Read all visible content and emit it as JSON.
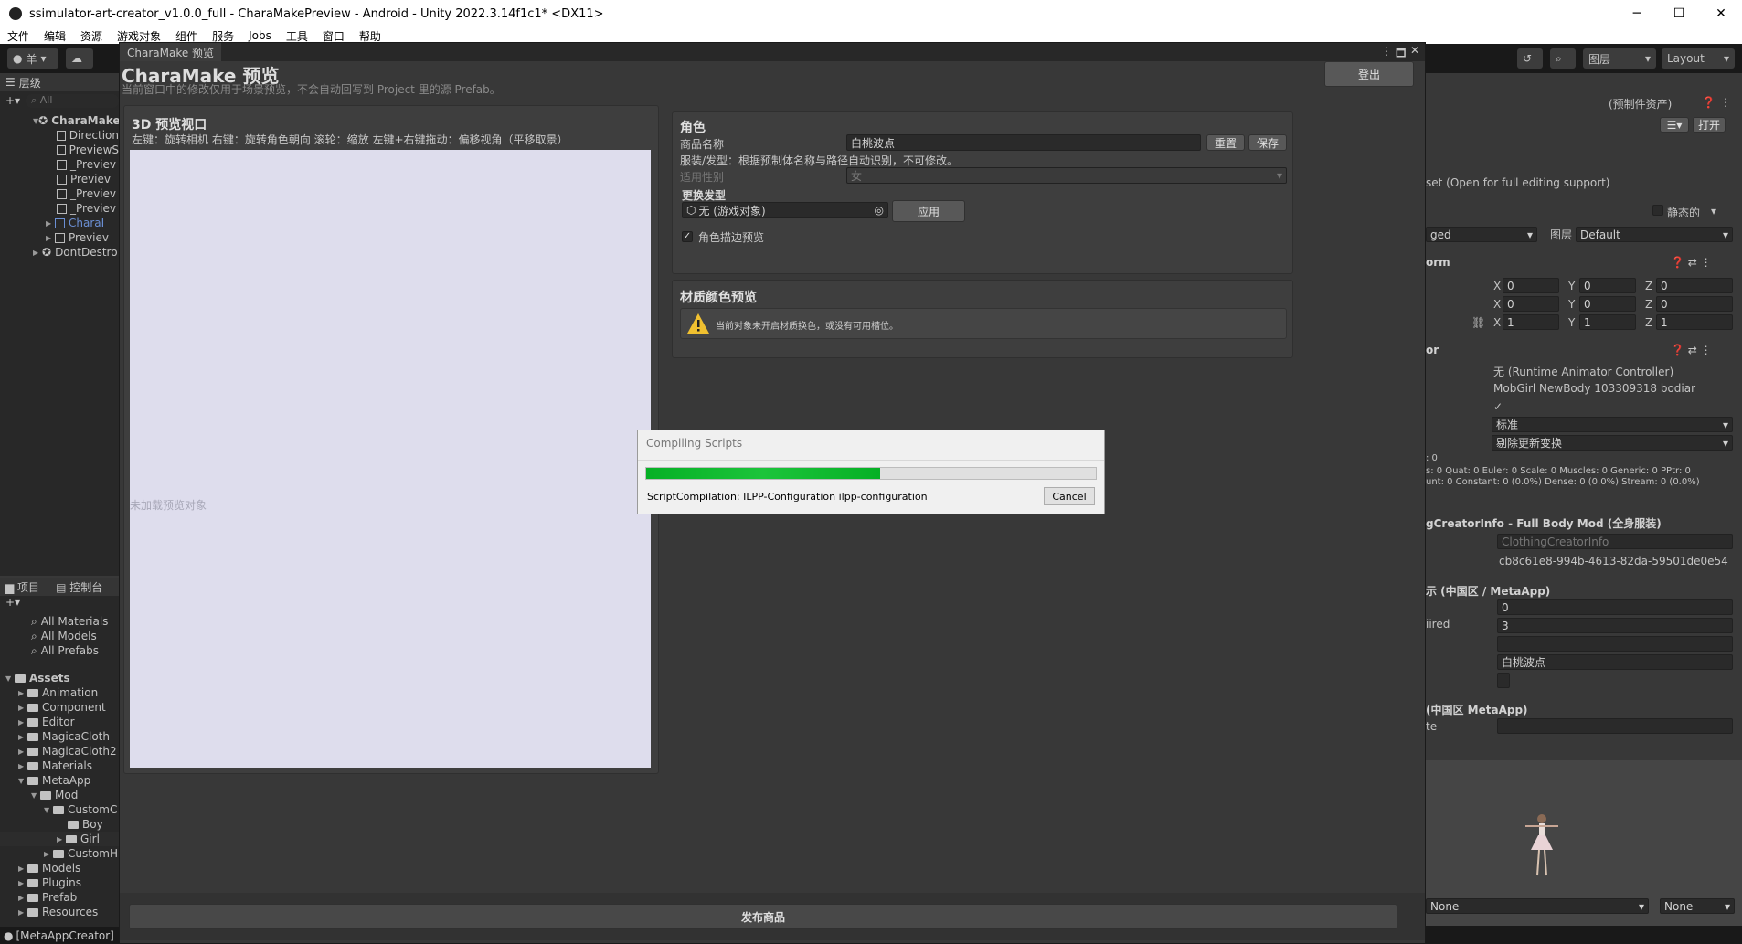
{
  "titlebar": {
    "title": "ssimulator-art-creator_v1.0.0_full - CharaMakePreview - Android - Unity 2022.3.14f1c1* <DX11>",
    "minimize": "─",
    "maximize": "☐",
    "close": "✕"
  },
  "menu": [
    "文件",
    "编辑",
    "资源",
    "游戏对象",
    "组件",
    "服务",
    "Jobs",
    "工具",
    "窗口",
    "帮助"
  ],
  "toolbar": {
    "account": "羊",
    "layers": "图层",
    "layout": "Layout"
  },
  "hierarchy": {
    "tab": "层级",
    "search": "All",
    "items": [
      "CharaMake",
      "Direction",
      "PreviewS",
      "_Previev",
      "Previev",
      "_Previev",
      "_Previev",
      "CharaI",
      "Previev",
      "DontDestro"
    ]
  },
  "project": {
    "tab_project": "项目",
    "tab_console": "控制台",
    "favorites": [
      "All Materials",
      "All Models",
      "All Prefabs"
    ],
    "assets_root": "Assets",
    "folders": [
      "Animation",
      "Component",
      "Editor",
      "MagicaCloth",
      "MagicaCloth2",
      "Materials",
      "MetaApp",
      "Mod",
      "CustomC",
      "Boy",
      "Girl",
      "CustomH",
      "Models",
      "Plugins",
      "Prefab",
      "Resources"
    ],
    "status": "[MetaAppCreator]"
  },
  "window": {
    "tab": "CharaMake 预览",
    "title": "CharaMake 预览",
    "subtitle": "当前窗口中的修改仅用于场景预览，不会自动回写到 Project 里的源 Prefab。",
    "logout": "登出"
  },
  "viewport": {
    "title": "3D 预览视口",
    "hint": "左键：旋转相机    右键：旋转角色朝向    滚轮：缩放    左键+右键拖动：偏移视角（平移取景）",
    "empty": "未加载预览对象"
  },
  "role": {
    "title": "角色",
    "name_label": "商品名称",
    "name_value": "白桃波点",
    "reset": "重置",
    "save": "保存",
    "info": "服装/发型：根据预制体名称与路径自动识别，不可修改。",
    "gender_label": "适用性别",
    "gender_value": "女",
    "hair_label": "更换发型",
    "hair_value": "无 (游戏对象)",
    "apply": "应用",
    "outline": "角色描边预览"
  },
  "material": {
    "title": "材质颜色预览",
    "warning": "当前对象未开启材质换色，或没有可用槽位。"
  },
  "publish": "发布商品",
  "dialog": {
    "title": "Compiling Scripts",
    "progress": 0.52,
    "status": "ScriptCompilation: ILPP-Configuration ilpp-configuration",
    "cancel": "Cancel"
  },
  "inspector": {
    "prefab_asset": "(预制件资产)",
    "open": "打开",
    "open_note": "set (Open for full editing support)",
    "static": "静态的",
    "tag": "ged",
    "layer_label": "图层",
    "layer": "Default",
    "transform": "orm",
    "pos": {
      "x": "0",
      "y": "0",
      "z": "0"
    },
    "rot": {
      "x": "0",
      "y": "0",
      "z": "0"
    },
    "scale": {
      "x": "1",
      "y": "1",
      "z": "1"
    },
    "animator": "or",
    "controller": "无 (Runtime Animator Controller)",
    "avatar": "MobGirl NewBody 103309318 bodiar",
    "update": "标准",
    "culling": "剔除更新变换",
    "clip_info1": "s: 0 Quat: 0 Euler: 0 Scale: 0 Muscles: 0 Generic: 0 PPtr: 0",
    "clip_info2": "unt: 0 Constant: 0 (0.0%) Dense: 0 (0.0%) Stream: 0 (0.0%)",
    "clip_info0": ": 0",
    "clothing": "gCreatorInfo - Full Body Mod (全身服装)",
    "clothing_script": "ClothingCreatorInfo",
    "guid": "cb8c61e8-994b-4613-82da-59501de0e54",
    "region": "示 (中国区 / MetaApp)",
    "v0": "0",
    "required_label": "iired",
    "v1": "3",
    "v3": "白桃波点",
    "region2": "(中国区 MetaApp)",
    "te": "te",
    "none1": "None",
    "none2": "None"
  }
}
